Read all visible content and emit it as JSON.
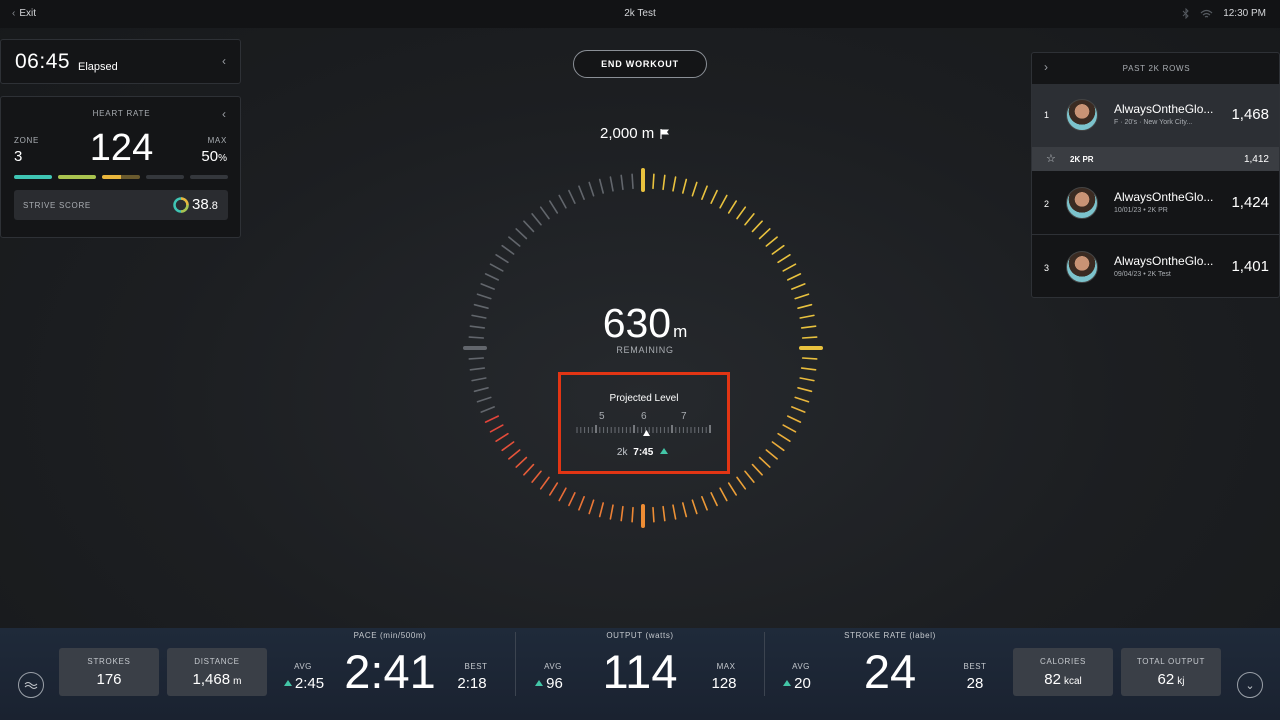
{
  "topbar": {
    "exit": "Exit",
    "title": "2k Test",
    "time": "12:30 PM"
  },
  "elapsed": {
    "time": "06:45",
    "label": "Elapsed"
  },
  "heart_rate": {
    "title": "HEART RATE",
    "zone_label": "ZONE",
    "zone": "3",
    "bpm": "124",
    "max_label": "MAX",
    "max_value": "50",
    "max_unit": "%",
    "strive_label": "STRIVE SCORE",
    "strive_int": "38",
    "strive_dec": ".8",
    "zone_colors": [
      "#3fc5b4",
      "#a9c34f",
      "#e9b63c"
    ]
  },
  "end_workout": "END WORKOUT",
  "goal_distance": "2,000 m",
  "remaining": {
    "value": "630",
    "unit": "m",
    "label": "REMAINING"
  },
  "progress_fraction": 0.685,
  "projected": {
    "title": "Projected Level",
    "levels": [
      "5",
      "6",
      "7"
    ],
    "current_level": 6,
    "prefix": "2k",
    "time": "7:45"
  },
  "leaderboard": {
    "title": "PAST 2K ROWS",
    "rows": [
      {
        "rank": "1",
        "name": "AlwaysOntheGlo...",
        "meta": "F · 20's · New York City...",
        "score": "1,468"
      },
      {
        "rank": "2",
        "name": "AlwaysOntheGlo...",
        "meta": "10/01/23 • 2K PR",
        "score": "1,424"
      },
      {
        "rank": "3",
        "name": "AlwaysOntheGlo...",
        "meta": "09/04/23 • 2K Test",
        "score": "1,401"
      }
    ],
    "pr_label": "2K PR",
    "pr_value": "1,412"
  },
  "metrics": {
    "strokes": {
      "label": "STROKES",
      "value": "176"
    },
    "distance": {
      "label": "DISTANCE",
      "value": "1,468",
      "unit": "m"
    },
    "pace": {
      "label": "PACE  (min/500m)",
      "value": "2:41",
      "avg_label": "AVG",
      "avg": "2:45",
      "best_label": "BEST",
      "best": "2:18"
    },
    "output": {
      "label": "OUTPUT  (watts)",
      "value": "114",
      "avg_label": "AVG",
      "avg": "96",
      "max_label": "MAX",
      "max": "128"
    },
    "stroke_rate": {
      "label": "STROKE RATE  (label)",
      "value": "24",
      "avg_label": "AVG",
      "avg": "20",
      "best_label": "BEST",
      "best": "28"
    },
    "calories": {
      "label": "CALORIES",
      "value": "82",
      "unit": "kcal"
    },
    "total_output": {
      "label": "TOTAL OUTPUT",
      "value": "62",
      "unit": "kj"
    }
  }
}
